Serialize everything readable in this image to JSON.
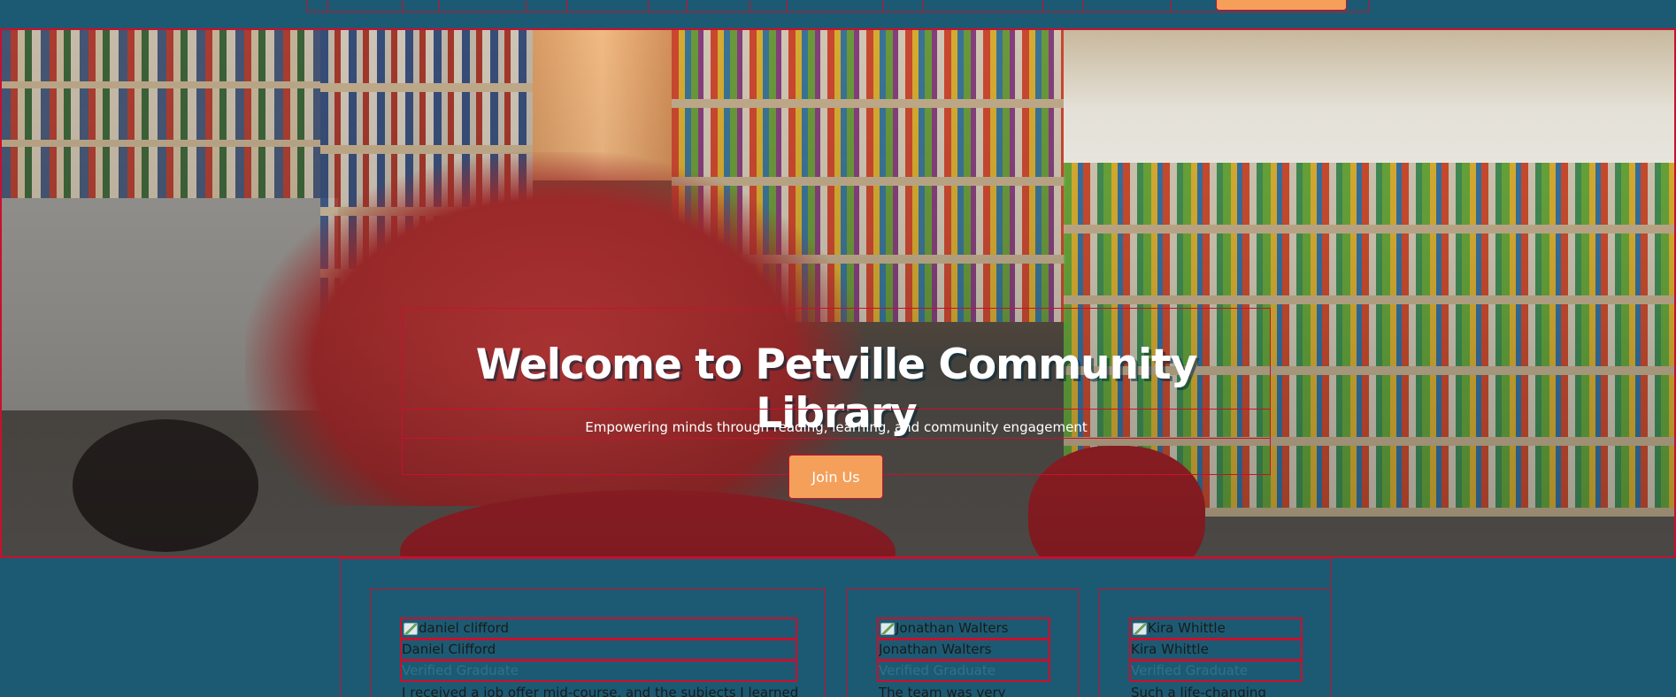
{
  "hero": {
    "title": "Welcome to Petville Community Library",
    "subtitle": "Empowering minds through reading, learning, and community engagement",
    "cta_label": "Join Us"
  },
  "testimonials": [
    {
      "image_alt": "daniel clifford",
      "name": "Daniel Clifford",
      "status": "Verified Graduate",
      "quote": "I received a job offer mid-course, and the subjects I learned"
    },
    {
      "image_alt": "Jonathan Walters",
      "name": "Jonathan Walters",
      "status": "Verified Graduate",
      "quote": "The team was very"
    },
    {
      "image_alt": "Kira Whittle",
      "name": "Kira Whittle",
      "status": "Verified Graduate",
      "quote": "Such a life-changing"
    }
  ],
  "colors": {
    "background": "#1c5a73",
    "accent": "#f4a05a",
    "outline": "#c8102e"
  }
}
